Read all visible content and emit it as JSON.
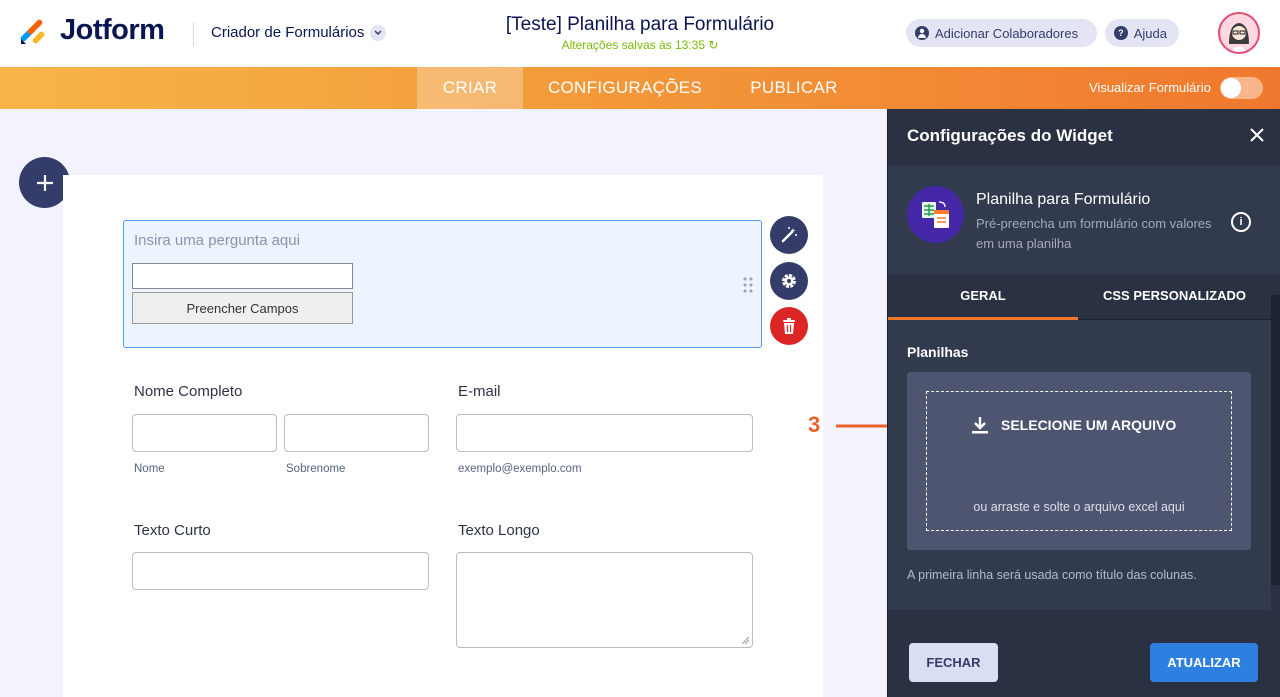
{
  "header": {
    "brand": "Jotform",
    "creator_label": "Criador de Formulários",
    "form_title": "[Teste] Planilha para Formulário",
    "saved_status": "Alterações salvas às 13:35",
    "collaborators_label": "Adicionar Colaboradores",
    "help_label": "Ajuda"
  },
  "nav": {
    "tabs": [
      "CRIAR",
      "CONFIGURAÇÕES",
      "PUBLICAR"
    ],
    "active_tab": "CRIAR",
    "preview_label": "Visualizar Formulário",
    "preview_on": false
  },
  "form": {
    "widget": {
      "placeholder": "Insira uma pergunta aqui",
      "fill_button": "Preencher Campos"
    },
    "fields": {
      "full_name": {
        "label": "Nome Completo",
        "first_sub": "Nome",
        "last_sub": "Sobrenome"
      },
      "email": {
        "label": "E-mail",
        "sub": "exemplo@exemplo.com"
      },
      "short_text": {
        "label": "Texto Curto"
      },
      "long_text": {
        "label": "Texto Longo"
      }
    }
  },
  "panel": {
    "title": "Configurações do Widget",
    "widget_name": "Planilha para Formulário",
    "widget_desc": "Pré-preencha um formulário com valores em uma planilha",
    "tabs": [
      "GERAL",
      "CSS PERSONALIZADO"
    ],
    "section_label": "Planilhas",
    "select_file": "SELECIONE UM ARQUIVO",
    "drag_text": "ou arraste e solte o arquivo excel aqui",
    "hint": "A primeira linha será usada como título das colunas.",
    "close_button": "FECHAR",
    "update_button": "ATUALIZAR"
  },
  "annotation": {
    "step": "3"
  },
  "colors": {
    "orange": "#f0782e",
    "navy": "#0a1551",
    "panel_bg": "#2a3143",
    "blue": "#2d7fe0"
  }
}
